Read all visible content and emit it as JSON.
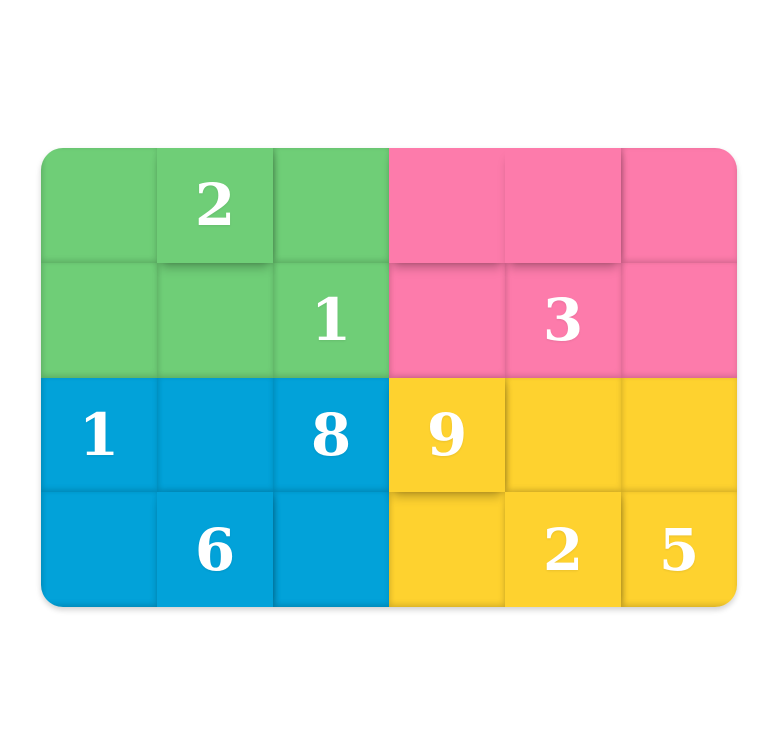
{
  "colors": {
    "green": "#6fce77",
    "pink": "#fd7bab",
    "blue": "#02a2d9",
    "yellow": "#fed22f"
  },
  "grid": {
    "rows": [
      [
        {
          "region": "green",
          "value": ""
        },
        {
          "region": "green",
          "value": "2"
        },
        {
          "region": "green",
          "value": ""
        },
        {
          "region": "pink",
          "value": ""
        },
        {
          "region": "pink",
          "value": ""
        },
        {
          "region": "pink",
          "value": ""
        }
      ],
      [
        {
          "region": "green",
          "value": ""
        },
        {
          "region": "green",
          "value": ""
        },
        {
          "region": "green",
          "value": "1"
        },
        {
          "region": "pink",
          "value": ""
        },
        {
          "region": "pink",
          "value": "3"
        },
        {
          "region": "pink",
          "value": ""
        }
      ],
      [
        {
          "region": "blue",
          "value": "1"
        },
        {
          "region": "blue",
          "value": ""
        },
        {
          "region": "blue",
          "value": "8"
        },
        {
          "region": "yellow",
          "value": "9"
        },
        {
          "region": "yellow",
          "value": ""
        },
        {
          "region": "yellow",
          "value": ""
        }
      ],
      [
        {
          "region": "blue",
          "value": ""
        },
        {
          "region": "blue",
          "value": "6"
        },
        {
          "region": "blue",
          "value": ""
        },
        {
          "region": "yellow",
          "value": ""
        },
        {
          "region": "yellow",
          "value": "2"
        },
        {
          "region": "yellow",
          "value": "5"
        }
      ]
    ]
  }
}
